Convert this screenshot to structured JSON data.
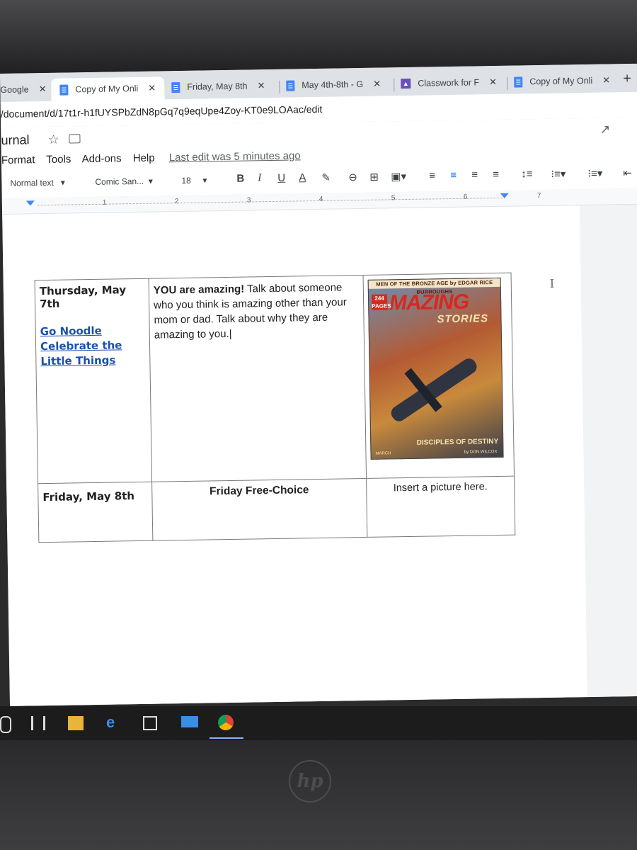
{
  "browser": {
    "tabs": [
      {
        "label": "Google",
        "icon": "google-icon"
      },
      {
        "label": "Copy of My Onli",
        "icon": "docs-icon",
        "active": true
      },
      {
        "label": "Friday, May 8th",
        "icon": "docs-icon"
      },
      {
        "label": "May 4th-8th - G",
        "icon": "docs-icon"
      },
      {
        "label": "Classwork for F",
        "icon": "classroom-icon"
      },
      {
        "label": "Copy of My Onli",
        "icon": "docs-icon"
      }
    ],
    "close_glyph": "✕",
    "new_tab_glyph": "+",
    "url": "/document/d/17t1r-h1fUYSPbZdN8pGq7q9eqUpe4Zoy-KT0e9LOAac/edit"
  },
  "docs": {
    "title": "urnal",
    "menu": [
      "Format",
      "Tools",
      "Add-ons",
      "Help"
    ],
    "last_edit": "Last edit was 5 minutes ago",
    "toolbar": {
      "style": "Normal text",
      "font": "Comic San...",
      "size": "18",
      "bold": "B",
      "italic": "I",
      "underline": "U",
      "text_color": "A"
    },
    "ruler_numbers": [
      "1",
      "2",
      "3",
      "4",
      "5",
      "6",
      "7"
    ]
  },
  "table": {
    "row1": {
      "date": "Thursday, May 7th",
      "links": [
        "Go Noodle",
        "Celebrate the Little Things"
      ],
      "prompt_bold": "YOU are amazing!",
      "prompt_rest": " Talk about someone who you think is amazing other than your mom or dad. Talk about why they are amazing to you.",
      "cover": {
        "top": "MEN OF THE BRONZE AGE by EDGAR RICE BURROUGHS",
        "num": "244 PAGES",
        "title": "AMAZING",
        "sub": "STORIES",
        "bottom": "DISCIPLES OF DESTINY",
        "author": "by DON WILCOX",
        "month": "MARCH"
      }
    },
    "row2": {
      "date": "Friday, May 8th",
      "middle": "Friday Free-Choice",
      "right": "Insert a picture here."
    }
  },
  "taskbar": {
    "icons": [
      "microphone-icon",
      "task-view-icon",
      "file-explorer-icon",
      "edge-icon",
      "store-icon",
      "mail-icon",
      "chrome-icon"
    ]
  },
  "device": {
    "brand": "hp"
  },
  "colors": {
    "docs_blue": "#4285f4",
    "link_blue": "#1a4fb0",
    "classroom_purple": "#6b4fbb"
  }
}
